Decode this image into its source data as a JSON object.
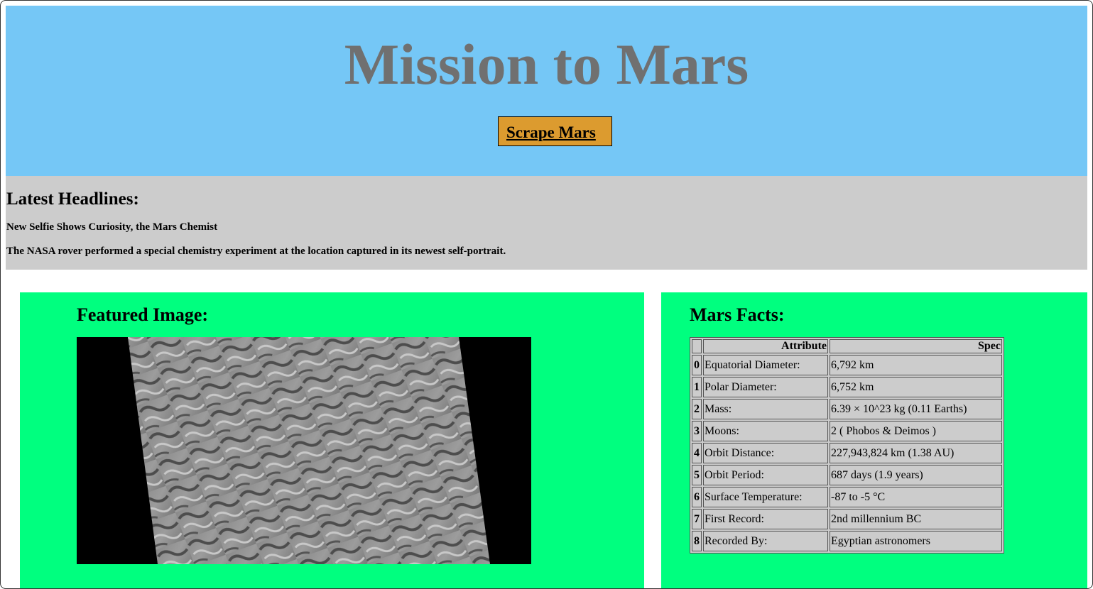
{
  "header": {
    "title": "Mission to Mars",
    "scrape_button": "Scrape Mars",
    "bg_color": "#75c7f6",
    "button_color": "#dc9b2f"
  },
  "headlines": {
    "heading": "Latest Headlines:",
    "news_title": "New Selfie Shows Curiosity, the Mars Chemist",
    "news_paragraph": "The NASA rover performed a special chemistry experiment at the location captured in its newest self-portrait."
  },
  "featured": {
    "heading": "Featured Image:",
    "image_alt": "grayscale Mars dune field image"
  },
  "facts": {
    "heading": "Mars Facts:",
    "columns": [
      "",
      "Attribute",
      "Spec"
    ],
    "rows": [
      {
        "idx": "0",
        "attribute": "Equatorial Diameter:",
        "spec": "6,792 km"
      },
      {
        "idx": "1",
        "attribute": "Polar Diameter:",
        "spec": "6,752 km"
      },
      {
        "idx": "2",
        "attribute": "Mass:",
        "spec": "6.39 × 10^23 kg (0.11 Earths)"
      },
      {
        "idx": "3",
        "attribute": "Moons:",
        "spec": "2 ( Phobos & Deimos )"
      },
      {
        "idx": "4",
        "attribute": "Orbit Distance:",
        "spec": "227,943,824 km (1.38 AU)"
      },
      {
        "idx": "5",
        "attribute": "Orbit Period:",
        "spec": "687 days (1.9 years)"
      },
      {
        "idx": "6",
        "attribute": "Surface Temperature:",
        "spec": "-87 to -5 °C"
      },
      {
        "idx": "7",
        "attribute": "First Record:",
        "spec": "2nd millennium BC"
      },
      {
        "idx": "8",
        "attribute": "Recorded By:",
        "spec": "Egyptian astronomers"
      }
    ]
  },
  "colors": {
    "panel": "#00ff7f",
    "headline_band": "#cccccc"
  }
}
